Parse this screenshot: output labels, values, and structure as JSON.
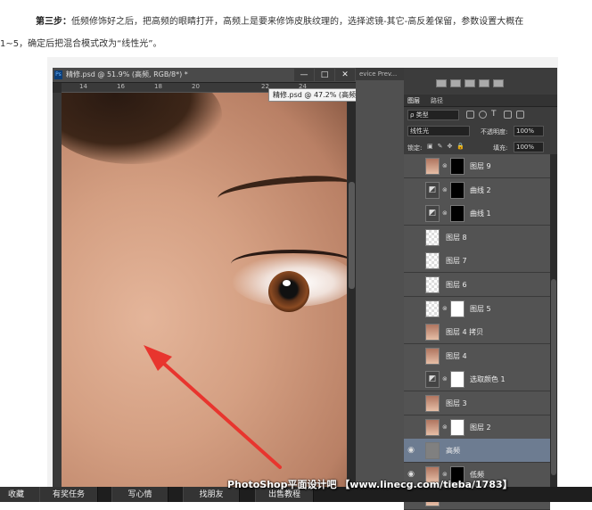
{
  "intro": {
    "step": "第三步：",
    "line1_rest": "低频修饰好之后，把高频的眼睛打开，高频上是要来修饰皮肤纹理的，选择滤镜-其它-高反差保留，参数设置大概在",
    "line2": "1~5，确定后把混合模式改为“线性光”。"
  },
  "window": {
    "tab_title": "精修.psd @ 51.9% (高频, RGB/8*) *",
    "dropdown_title": "精修.psd @ 47.2% (高频, RGB/8*) *",
    "device": "evice Prev...",
    "min": "—",
    "max": "□",
    "close": "✕"
  },
  "ruler": {
    "ticks": [
      "14",
      "16",
      "18",
      "20",
      "",
      "",
      "22",
      "24"
    ]
  },
  "panel": {
    "tabs": [
      "图层",
      "路径"
    ],
    "kind": "ρ 类型",
    "blend": "线性光",
    "opacity_label": "不透明度:",
    "opacity": "100%",
    "lock_label": "锁定:",
    "fill_label": "填充:",
    "fill": "100%"
  },
  "layers": [
    {
      "name": "图层 9",
      "thumb": "p",
      "mask": "b"
    },
    {
      "name": "曲线 2",
      "thumb": "adj",
      "mask": "b"
    },
    {
      "name": "曲线 1",
      "thumb": "adj",
      "mask": "b"
    },
    {
      "name": "图层 8",
      "thumb": "t"
    },
    {
      "name": "图层 7",
      "thumb": "t"
    },
    {
      "name": "图层 6",
      "thumb": "t"
    },
    {
      "name": "图层 5",
      "thumb": "t",
      "mask": "w"
    },
    {
      "name": "图层 4 拷贝",
      "thumb": "p"
    },
    {
      "name": "图层 4",
      "thumb": "p"
    },
    {
      "name": "选取颜色 1",
      "thumb": "adj",
      "mask": "w"
    },
    {
      "name": "图层 3",
      "thumb": "p"
    },
    {
      "name": "图层 2",
      "thumb": "p",
      "mask": "w"
    },
    {
      "name": "高频",
      "thumb": "g",
      "visible": true,
      "selected": true
    },
    {
      "name": "低频",
      "thumb": "p",
      "mask": "b",
      "visible": true
    },
    {
      "name": "图层 1",
      "thumb": "p"
    }
  ],
  "watermark": "PhotoShop平面设计吧 【www.linecg.com/tieba/1783】",
  "bottom_buttons": [
    "收藏",
    "有奖任务",
    "写心情",
    "找朋友",
    "出售教程"
  ],
  "icons": {
    "arrow": "red-arrow-icon",
    "eye": "eye-icon"
  }
}
